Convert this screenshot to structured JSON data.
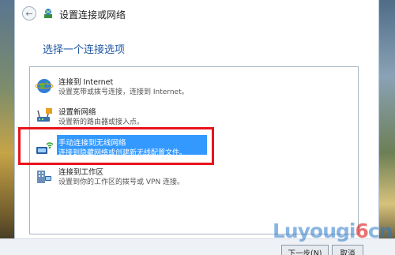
{
  "window": {
    "title": "设置连接或网络",
    "back_glyph": "←"
  },
  "heading": "选择一个连接选项",
  "options": [
    {
      "title": "连接到 Internet",
      "description": "设置宽带或拨号连接，连接到 Internet。",
      "icon": "globe-network-icon"
    },
    {
      "title": "设置新网络",
      "description": "设置新的路由器或接入点。",
      "icon": "router-network-icon"
    },
    {
      "title": "手动连接到无线网络",
      "description": "连接到隐藏网络或创建新无线配置文件。",
      "icon": "wireless-network-icon",
      "selected": true
    },
    {
      "title": "连接到工作区",
      "description": "设置到你的工作区的拨号或 VPN 连接。",
      "icon": "workplace-network-icon"
    }
  ],
  "buttons": {
    "next": "下一步(N)",
    "cancel": "取消"
  },
  "watermark": {
    "part1": "Luyou",
    "part2": "gi",
    "part3": "6",
    "part4": "cn"
  },
  "colors": {
    "heading": "#1f57a0",
    "selection": "#3399ff",
    "highlight_box": "#e8141c"
  }
}
